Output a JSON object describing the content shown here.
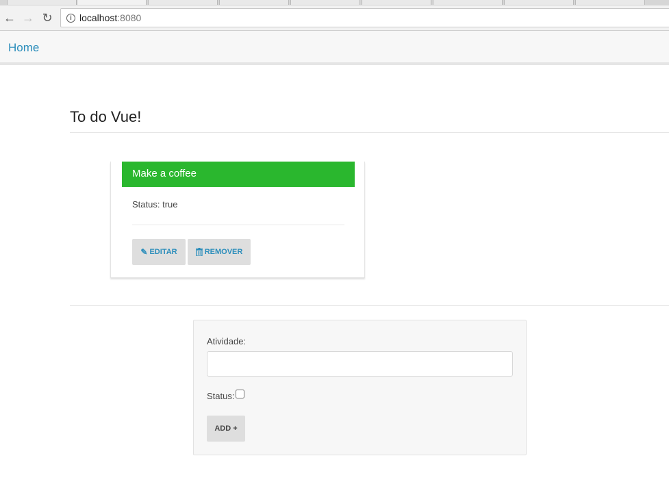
{
  "browser": {
    "url_host": "localhost",
    "url_port": ":8080"
  },
  "nav": {
    "home_label": "Home"
  },
  "page": {
    "title": "To do Vue!"
  },
  "todo": {
    "title": "Make a coffee",
    "status_text": "Status: true",
    "edit_label": "EDITAR",
    "remove_label": "REMOVER",
    "header_color": "#2ab72e"
  },
  "form": {
    "activity_label": "Atividade:",
    "activity_value": "",
    "status_label": "Status:",
    "status_checked": false,
    "add_label": "ADD +"
  },
  "icons": {
    "edit": "pencil-icon",
    "remove": "trash-icon"
  }
}
